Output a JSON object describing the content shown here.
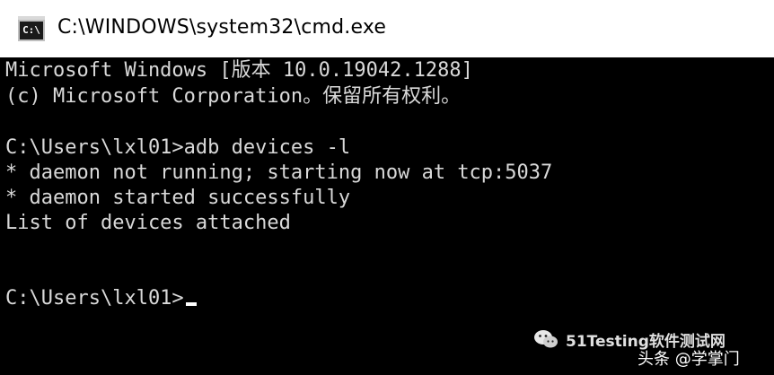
{
  "window": {
    "title": "C:\\WINDOWS\\system32\\cmd.exe",
    "icon_label": "C:\\",
    "icon": "cmd-icon"
  },
  "terminal": {
    "lines": [
      "Microsoft Windows [版本 10.0.19042.1288]",
      "(c) Microsoft Corporation。保留所有权利。",
      "",
      "C:\\Users\\lxl01>adb devices -l",
      "* daemon not running; starting now at tcp:5037",
      "* daemon started successfully",
      "List of devices attached",
      "",
      "",
      "C:\\Users\\lxl01>"
    ]
  },
  "watermarks": {
    "brand": "51Testing软件测试网",
    "brand_icon": "wechat-icon",
    "source": "头条 @学掌门"
  },
  "colors": {
    "terminal_bg": "#000000",
    "terminal_text": "#d9d9d9",
    "titlebar_bg": "#ffffff"
  }
}
